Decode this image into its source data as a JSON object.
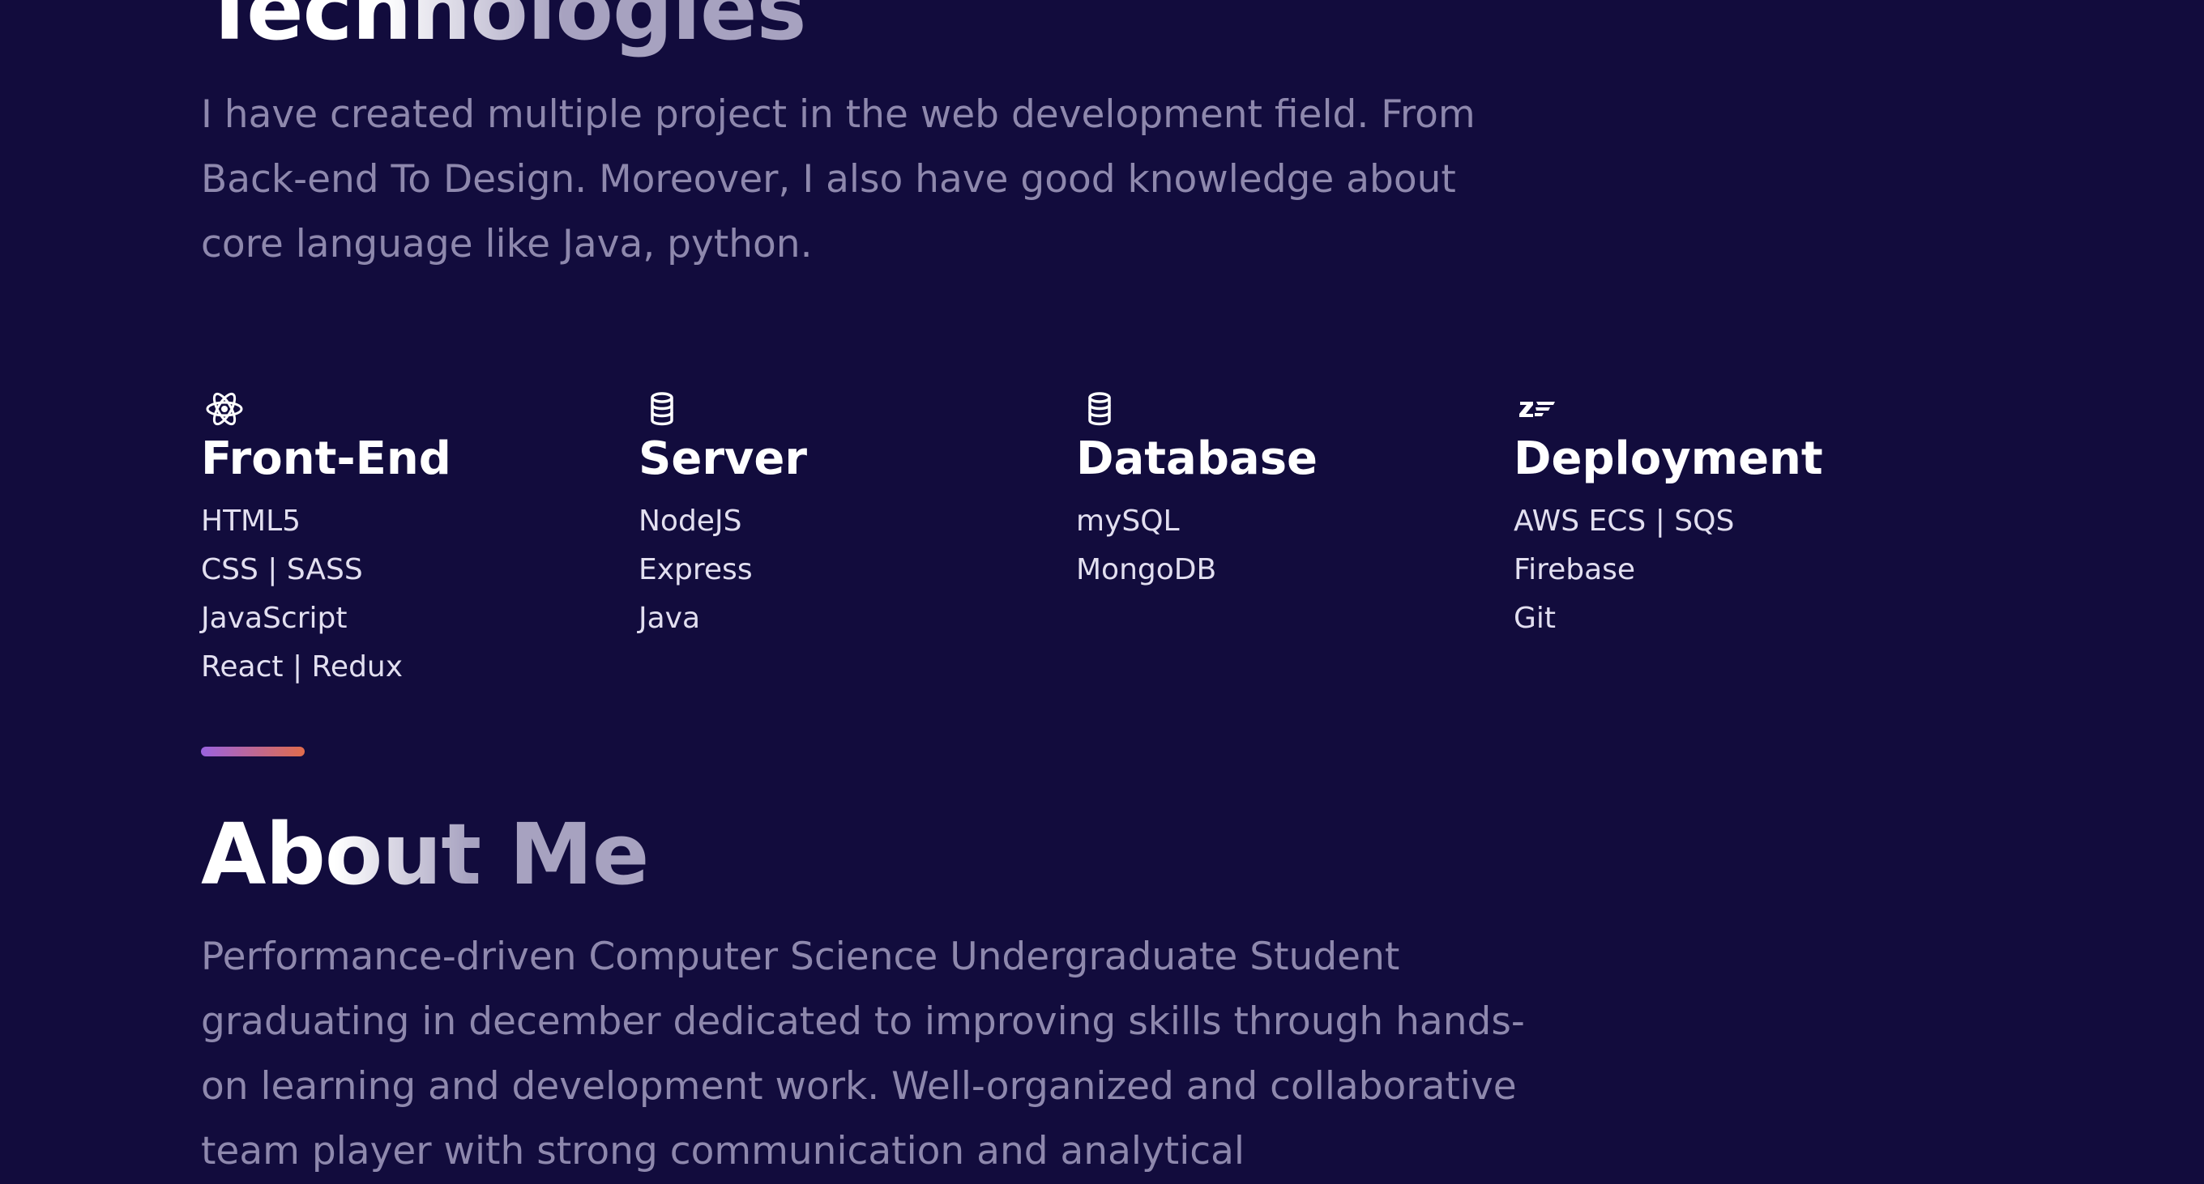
{
  "technologies": {
    "title": "Technologies",
    "description": "I have created multiple project in the web development field. From Back-end To Design. Moreover, I also have good knowledge about core language like Java, python.",
    "categories": [
      {
        "icon": "react-atom-icon",
        "title": "Front-End",
        "items": [
          "HTML5",
          "CSS | SASS",
          "JavaScript",
          "React | Redux"
        ]
      },
      {
        "icon": "database-icon",
        "title": "Server",
        "items": [
          "NodeJS",
          "Express",
          "Java"
        ]
      },
      {
        "icon": "database-icon",
        "title": "Database",
        "items": [
          "mySQL",
          "MongoDB"
        ]
      },
      {
        "icon": "zend-framework-icon",
        "title": "Deployment",
        "items": [
          "AWS ECS | SQS",
          "Firebase",
          "Git"
        ]
      }
    ]
  },
  "about": {
    "title": "About Me",
    "description": "Performance-driven Computer Science Undergraduate Student graduating in december dedicated to improving skills through hands-on learning and development work. Well-organized and collaborative team player with strong communication and analytical"
  },
  "colors": {
    "background": "#120c3d",
    "muted_text": "#8e88ad",
    "divider_start": "#9a63e0",
    "divider_end": "#e06c4c"
  }
}
